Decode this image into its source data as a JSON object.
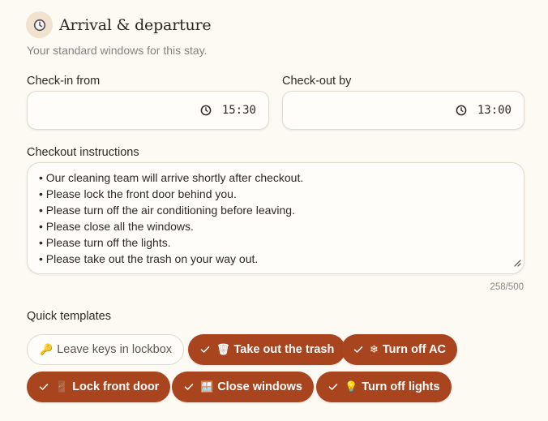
{
  "header": {
    "title": "Arrival & departure",
    "subtitle": "Your standard windows for this stay.",
    "icon": "clock-icon"
  },
  "checkin": {
    "label": "Check-in from",
    "value": "15:30"
  },
  "checkout": {
    "label": "Check-out by",
    "value": "13:00"
  },
  "instructions": {
    "label": "Checkout instructions",
    "lines": [
      "• Our cleaning team will arrive shortly after checkout.",
      "• Please lock the front door behind you.",
      "• Please turn off the air conditioning before leaving.",
      "• Please close all the windows.",
      "• Please turn off the lights.",
      "• Please take out the trash on your way out."
    ],
    "counter": "258/500"
  },
  "templates": {
    "label": "Quick templates",
    "chips": [
      {
        "emoji": "🔑",
        "label": "Leave keys in lockbox",
        "selected": false
      },
      {
        "emoji": "🗑",
        "label": "Take out the trash",
        "selected": true
      },
      {
        "emoji": "❄",
        "label": "Turn off AC",
        "selected": true
      },
      {
        "emoji": "🚪",
        "label": "Lock front door",
        "selected": true
      },
      {
        "emoji": "🪟",
        "label": "Close windows",
        "selected": true
      },
      {
        "emoji": "💡",
        "label": "Turn off lights",
        "selected": true
      }
    ]
  },
  "colors": {
    "accent": "#a8441e",
    "background": "#fdfaf4",
    "badge": "#f1e2d0"
  }
}
